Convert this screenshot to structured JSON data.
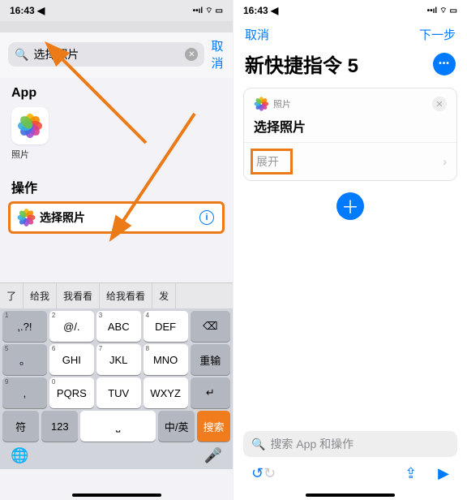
{
  "status": {
    "time": "16:43",
    "loc": "◀",
    "signal": "⋮⋮",
    "wifi": "⏚",
    "batt": "▭"
  },
  "left": {
    "dimtext": "照片",
    "search": {
      "value": "选择照片",
      "cancel": "取消"
    },
    "sec_app": "App",
    "photos_label": "照片",
    "sec_action": "操作",
    "action_title": "选择照片",
    "suggest": [
      "了",
      "给我",
      "我看看",
      "给我看看",
      "发"
    ],
    "keys": {
      "r1": [
        ",.?!",
        "@/.",
        "ABC",
        "DEF"
      ],
      "r2": [
        "。",
        "GHI",
        "JKL",
        "MNO"
      ],
      "r3": [
        ",",
        "PQRS",
        "TUV",
        "WXYZ"
      ],
      "r4": [
        "符",
        "123",
        "",
        "中/英"
      ],
      "nums": [
        "1",
        "2",
        "3",
        "4",
        "5",
        "6",
        "7",
        "8",
        "9",
        "0"
      ],
      "del": "⌫",
      "reinput": "重输",
      "enter": "↵",
      "search": "搜索",
      "space": "空格"
    }
  },
  "right": {
    "cancel": "取消",
    "next": "下一步",
    "title": "新快捷指令 5",
    "card_app": "照片",
    "card_title": "选择照片",
    "expand": "展开",
    "searchplaceholder": "搜索 App 和操作"
  },
  "petals": [
    "#f6b400",
    "#f48b00",
    "#ef4e3b",
    "#d83e8e",
    "#9b4fd1",
    "#3d6de0",
    "#36b0e0",
    "#6cc24a"
  ]
}
